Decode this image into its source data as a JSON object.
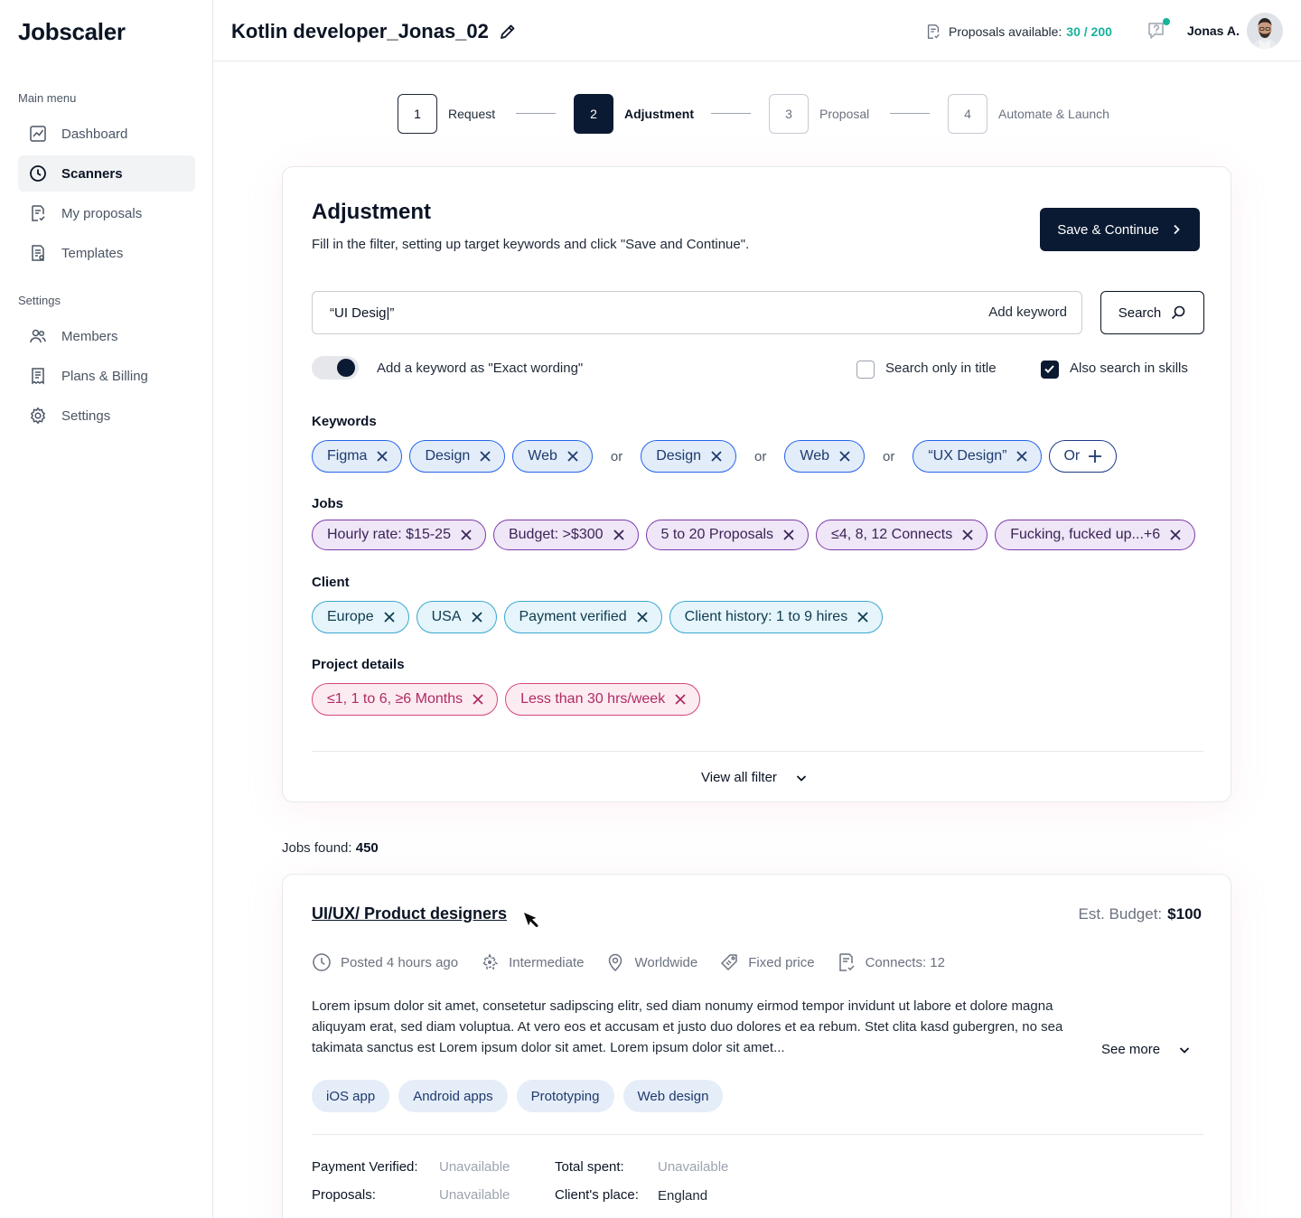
{
  "app": {
    "logo": "Jobscaler"
  },
  "sidebar": {
    "main_menu_title": "Main menu",
    "settings_title": "Settings",
    "main_items": [
      {
        "label": "Dashboard",
        "icon": "chart-icon"
      },
      {
        "label": "Scanners",
        "icon": "clock-icon",
        "active": true
      },
      {
        "label": "My proposals",
        "icon": "proposal-icon"
      },
      {
        "label": "Templates",
        "icon": "template-icon"
      }
    ],
    "settings_items": [
      {
        "label": "Members",
        "icon": "members-icon"
      },
      {
        "label": "Plans & Billing",
        "icon": "billing-icon"
      },
      {
        "label": "Settings",
        "icon": "gear-icon"
      }
    ]
  },
  "header": {
    "title": "Kotlin developer_Jonas_02",
    "proposals_label": "Proposals available:",
    "proposals_count": "30 / 200",
    "user_name": "Jonas A."
  },
  "stepper": {
    "steps": [
      {
        "number": "1",
        "label": "Request",
        "state": "done"
      },
      {
        "number": "2",
        "label": "Adjustment",
        "state": "active"
      },
      {
        "number": "3",
        "label": "Proposal",
        "state": "pending"
      },
      {
        "number": "4",
        "label": "Automate & Launch",
        "state": "pending"
      }
    ]
  },
  "adjustment": {
    "title": "Adjustment",
    "subtitle": "Fill in the filter, setting up target keywords and click \"Save and Continue\".",
    "save_label": "Save & Continue",
    "keyword_value": "“UI Desig|”",
    "add_keyword_label": "Add keyword",
    "search_label": "Search",
    "exact_wording_label": "Add a keyword as \"Exact wording\"",
    "search_title_label": "Search only in title",
    "search_title_checked": false,
    "search_skills_label": "Also search in skills",
    "search_skills_checked": true,
    "sections": {
      "keywords": "Keywords",
      "jobs": "Jobs",
      "client": "Client",
      "project": "Project details"
    },
    "keyword_groups": [
      [
        "Figma",
        "Design",
        "Web"
      ],
      [
        "Design"
      ],
      [
        "Web"
      ],
      [
        "“UX Design”"
      ]
    ],
    "or_label": "or",
    "or_button_label": "Or",
    "jobs_chips": [
      "Hourly rate: $15-25",
      "Budget: >$300",
      "5 to 20 Proposals",
      "≤4, 8, 12 Connects",
      "Fucking, fucked up...+6"
    ],
    "client_chips": [
      "Europe",
      "USA",
      "Payment verified",
      "Client history: 1 to 9 hires"
    ],
    "project_chips": [
      "≤1, 1 to 6, ≥6 Months",
      "Less than 30 hrs/week"
    ],
    "view_all_label": "View all filter"
  },
  "results": {
    "jobs_found_label": "Jobs found:",
    "jobs_found_count": "450"
  },
  "job": {
    "title": "UI/UX/ Product designers",
    "budget_label": "Est. Budget:",
    "budget_value": "$100",
    "meta": [
      {
        "icon": "clock-icon",
        "text": "Posted 4 hours ago"
      },
      {
        "icon": "level-icon",
        "text": "Intermediate"
      },
      {
        "icon": "location-icon",
        "text": "Worldwide"
      },
      {
        "icon": "price-tag-icon",
        "text": "Fixed price"
      },
      {
        "icon": "connects-icon",
        "text": "Connects: 12"
      }
    ],
    "description": "Lorem ipsum dolor sit amet, consetetur sadipscing elitr, sed diam nonumy eirmod tempor invidunt ut labore et dolore magna aliquyam erat, sed diam voluptua. At vero eos et accusam et justo duo dolores et ea rebum. Stet clita kasd gubergren, no sea takimata sanctus est Lorem ipsum dolor sit amet. Lorem ipsum dolor sit amet...",
    "see_more_label": "See more",
    "tags": [
      "iOS app",
      "Android apps",
      "Prototyping",
      "Web design"
    ],
    "info": {
      "payment_verified_label": "Payment Verified:",
      "payment_verified_value": "Unavailable",
      "proposals_label": "Proposals:",
      "proposals_value": "Unavailable",
      "total_spent_label": "Total spent:",
      "total_spent_value": "Unavailable",
      "client_place_label": "Client's place:",
      "client_place_value": "England"
    }
  }
}
